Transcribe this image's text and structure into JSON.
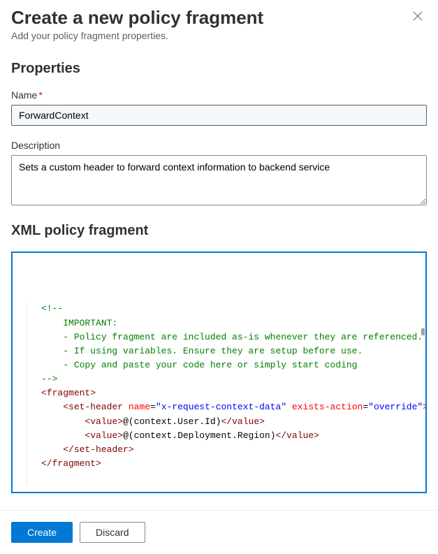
{
  "header": {
    "title": "Create a new policy fragment",
    "subtitle": "Add your policy fragment properties."
  },
  "sections": {
    "properties_heading": "Properties",
    "xml_heading": "XML policy fragment"
  },
  "fields": {
    "name": {
      "label": "Name",
      "value": "ForwardContext",
      "required": true
    },
    "description": {
      "label": "Description",
      "value": "Sets a custom header to forward context information to backend service"
    }
  },
  "code": {
    "lines": [
      {
        "indent": 0,
        "segs": [
          {
            "cls": "c-comment",
            "t": "<!--"
          }
        ]
      },
      {
        "indent": 1,
        "segs": [
          {
            "cls": "c-comment",
            "t": "IMPORTANT:"
          }
        ]
      },
      {
        "indent": 1,
        "segs": [
          {
            "cls": "c-comment",
            "t": "- Policy fragment are included as-is whenever they are referenced."
          }
        ]
      },
      {
        "indent": 1,
        "segs": [
          {
            "cls": "c-comment",
            "t": "- If using variables. Ensure they are setup before use."
          }
        ]
      },
      {
        "indent": 1,
        "segs": [
          {
            "cls": "c-comment",
            "t": "- Copy and paste your code here or simply start coding"
          }
        ]
      },
      {
        "indent": 0,
        "segs": [
          {
            "cls": "c-comment",
            "t": "-->"
          }
        ]
      },
      {
        "indent": 0,
        "segs": [
          {
            "cls": "c-bracket",
            "t": "<"
          },
          {
            "cls": "c-tag",
            "t": "fragment"
          },
          {
            "cls": "c-bracket",
            "t": ">"
          }
        ]
      },
      {
        "indent": 1,
        "segs": [
          {
            "cls": "c-bracket",
            "t": "<"
          },
          {
            "cls": "c-tag",
            "t": "set-header"
          },
          {
            "cls": "c-text",
            "t": " "
          },
          {
            "cls": "c-attr",
            "t": "name"
          },
          {
            "cls": "c-text",
            "t": "="
          },
          {
            "cls": "c-string",
            "t": "\"x-request-context-data\""
          },
          {
            "cls": "c-text",
            "t": " "
          },
          {
            "cls": "c-attr",
            "t": "exists-action"
          },
          {
            "cls": "c-text",
            "t": "="
          },
          {
            "cls": "c-string",
            "t": "\"override\""
          },
          {
            "cls": "c-bracket",
            "t": ">"
          }
        ]
      },
      {
        "indent": 2,
        "segs": [
          {
            "cls": "c-bracket",
            "t": "<"
          },
          {
            "cls": "c-tag",
            "t": "value"
          },
          {
            "cls": "c-bracket",
            "t": ">"
          },
          {
            "cls": "c-text",
            "t": "@(context.User.Id)"
          },
          {
            "cls": "c-bracket",
            "t": "</"
          },
          {
            "cls": "c-tag",
            "t": "value"
          },
          {
            "cls": "c-bracket",
            "t": ">"
          }
        ]
      },
      {
        "indent": 2,
        "segs": [
          {
            "cls": "c-bracket",
            "t": "<"
          },
          {
            "cls": "c-tag",
            "t": "value"
          },
          {
            "cls": "c-bracket",
            "t": ">"
          },
          {
            "cls": "c-text",
            "t": "@(context.Deployment.Region)"
          },
          {
            "cls": "c-bracket",
            "t": "</"
          },
          {
            "cls": "c-tag",
            "t": "value"
          },
          {
            "cls": "c-bracket",
            "t": ">"
          }
        ]
      },
      {
        "indent": 1,
        "segs": [
          {
            "cls": "c-bracket",
            "t": "</"
          },
          {
            "cls": "c-tag",
            "t": "set-header"
          },
          {
            "cls": "c-bracket",
            "t": ">"
          }
        ]
      },
      {
        "indent": 0,
        "segs": [
          {
            "cls": "c-bracket",
            "t": "</"
          },
          {
            "cls": "c-tag",
            "t": "fragment"
          },
          {
            "cls": "c-bracket",
            "t": ">"
          }
        ]
      }
    ]
  },
  "footer": {
    "create_label": "Create",
    "discard_label": "Discard"
  }
}
